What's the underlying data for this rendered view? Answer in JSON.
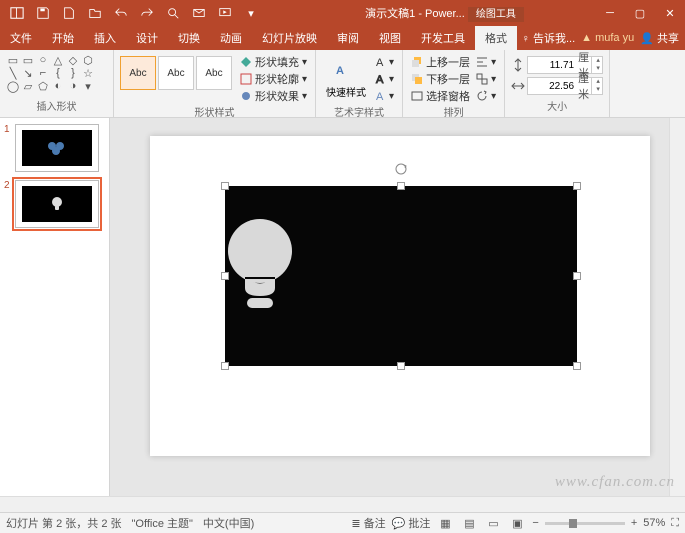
{
  "title": "演示文稿1 - Power...",
  "contextual_tab": "绘图工具",
  "user": "mufa yu",
  "share": "共享",
  "tell_me": "告诉我...",
  "tabs": {
    "file": "文件",
    "home": "开始",
    "insert": "插入",
    "design": "设计",
    "transitions": "切换",
    "animations": "动画",
    "slideshow": "幻灯片放映",
    "review": "审阅",
    "view": "视图",
    "devtools": "开发工具",
    "format": "格式"
  },
  "ribbon": {
    "insert_shapes": "插入形状",
    "shape_styles": "形状样式",
    "wordart_styles": "艺术字样式",
    "arrange": "排列",
    "size": "大小",
    "abc": "Abc",
    "shape_fill": "形状填充",
    "shape_outline": "形状轮廓",
    "shape_effects": "形状效果",
    "quick_styles": "快速样式",
    "bring_forward": "上移一层",
    "send_backward": "下移一层",
    "selection_pane": "选择窗格",
    "height": "11.71",
    "width": "22.56",
    "unit": "厘米"
  },
  "slides": {
    "s1": "1",
    "s2": "2"
  },
  "statusbar": {
    "slide_info": "幻灯片 第 2 张，共 2 张",
    "theme": "\"Office 主题\"",
    "notes": "备注",
    "comments": "批注",
    "lang": "中文(中国)",
    "zoom": "57%"
  },
  "watermark": "www.cfan.com.cn"
}
